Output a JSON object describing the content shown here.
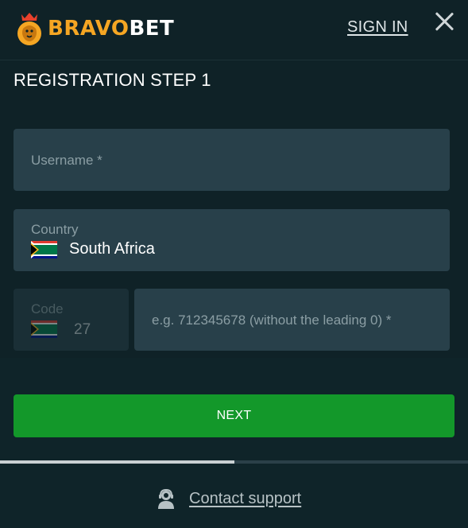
{
  "brand": {
    "name_part1": "BRAVO",
    "name_part2": "BET",
    "accent": "#f5a623"
  },
  "header": {
    "signin_label": "SIGN IN",
    "close_icon": "close-icon"
  },
  "page": {
    "title": "REGISTRATION STEP 1"
  },
  "form": {
    "username": {
      "placeholder": "Username *",
      "value": ""
    },
    "country": {
      "label": "Country",
      "value": "South Africa",
      "flag": "south-africa-flag-icon"
    },
    "code": {
      "label": "Code",
      "value": "27",
      "flag": "south-africa-flag-icon"
    },
    "phone": {
      "placeholder": "e.g. 712345678 (without the leading 0) *",
      "value": ""
    }
  },
  "actions": {
    "next_label": "NEXT",
    "next_color": "#13982a"
  },
  "progress": {
    "fraction": 0.5
  },
  "footer": {
    "support_label": "Contact support",
    "support_icon": "support-agent-icon"
  }
}
